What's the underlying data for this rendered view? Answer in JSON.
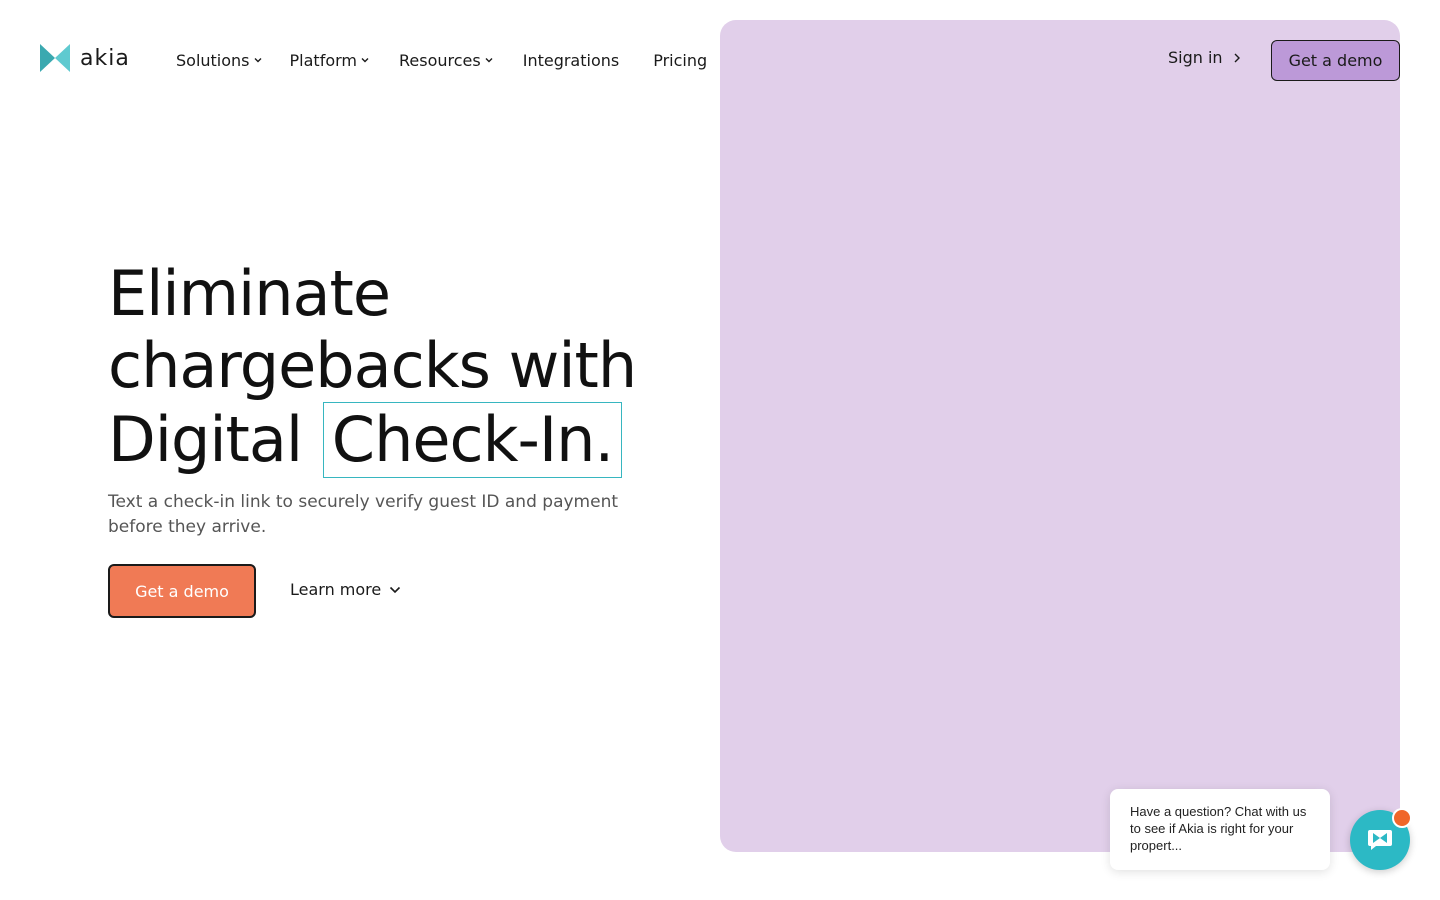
{
  "brand": {
    "name": "akia",
    "logo_color": "#4fc3c8",
    "icon": "akia-bowtie-logo-icon"
  },
  "nav": {
    "items": [
      {
        "label": "Solutions",
        "has_dropdown": true
      },
      {
        "label": "Platform",
        "has_dropdown": true
      },
      {
        "label": "Resources",
        "has_dropdown": true
      },
      {
        "label": "Integrations",
        "has_dropdown": false
      },
      {
        "label": "Pricing",
        "has_dropdown": false
      }
    ],
    "sign_in": "Sign in",
    "demo_button": "Get a demo",
    "demo_button_color": "#bc99d8"
  },
  "hero": {
    "headline_line1": "Eliminate",
    "headline_line2": "chargebacks with",
    "headline_line3_prefix": "Digital",
    "headline_highlight": "Check-In.",
    "subtitle": "Text a check-in link to securely verify guest ID and payment before they arrive.",
    "cta_primary": "Get a demo",
    "cta_primary_color": "#f07a55",
    "cta_secondary": "Learn more",
    "panel_color": "#e1cfea"
  },
  "chat": {
    "message": "Have a question? Chat with us to see if Akia is right for your propert...",
    "launcher_color": "#2cb9c5",
    "notification_color": "#f0662a",
    "icon": "chat-logo-icon"
  }
}
